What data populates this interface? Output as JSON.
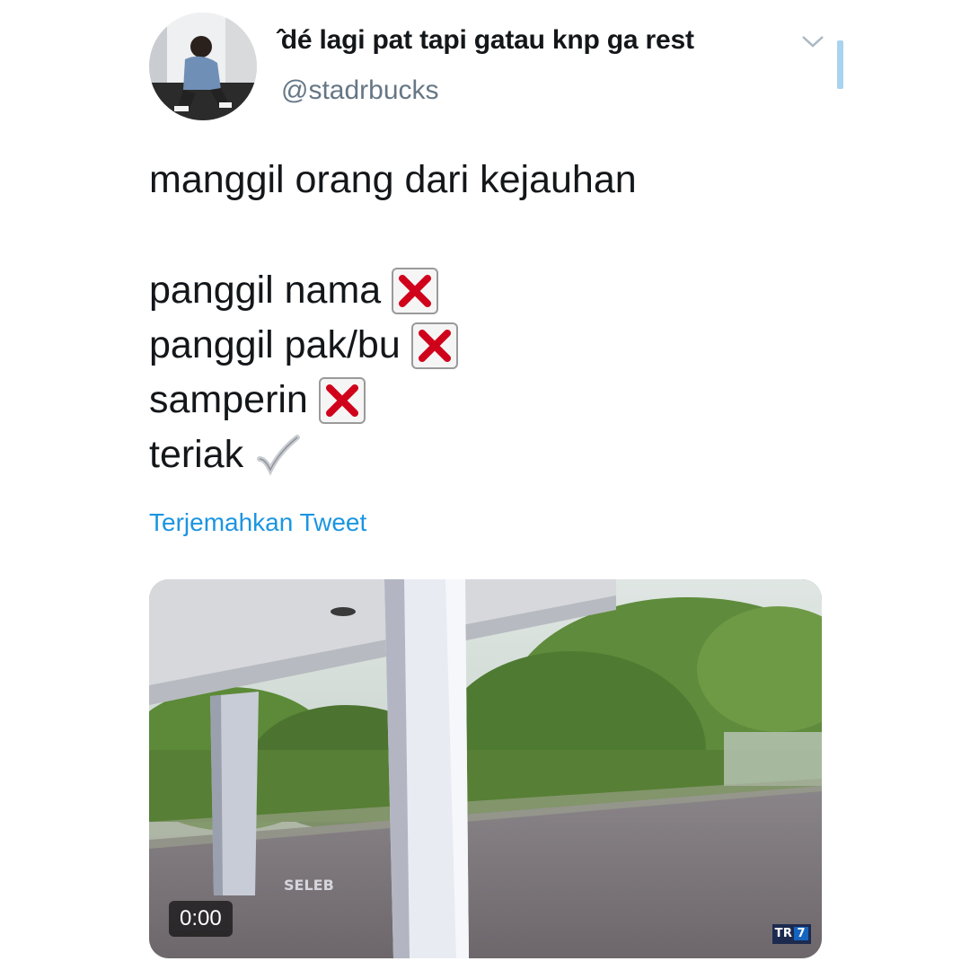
{
  "tweet": {
    "author": {
      "display_name": "̂dé lagi pat tapi gatau knp ga rest",
      "handle": "@stadrbucks",
      "avatar_icon": "user-avatar"
    },
    "menu_icon": "chevron-down-icon",
    "lines": [
      {
        "text": "manggil orang dari kejauhan",
        "icon": null
      },
      {
        "text": "",
        "icon": null
      },
      {
        "text": "panggil nama",
        "icon": "cross-mark-icon"
      },
      {
        "text": "panggil pak/bu",
        "icon": "cross-mark-icon"
      },
      {
        "text": "samperin",
        "icon": "cross-mark-icon"
      },
      {
        "text": "teriak",
        "icon": "check-mark-icon"
      }
    ],
    "translate_label": "Terjemahkan Tweet",
    "media": {
      "type": "video",
      "duration": "0:00",
      "channel_logo_text": "TR",
      "channel_logo_num": "7",
      "watermark_text": "SELEB"
    }
  },
  "colors": {
    "link": "#1b95e0",
    "handle": "#657786",
    "cross": "#d0021b",
    "check": "#c9ccd1"
  }
}
